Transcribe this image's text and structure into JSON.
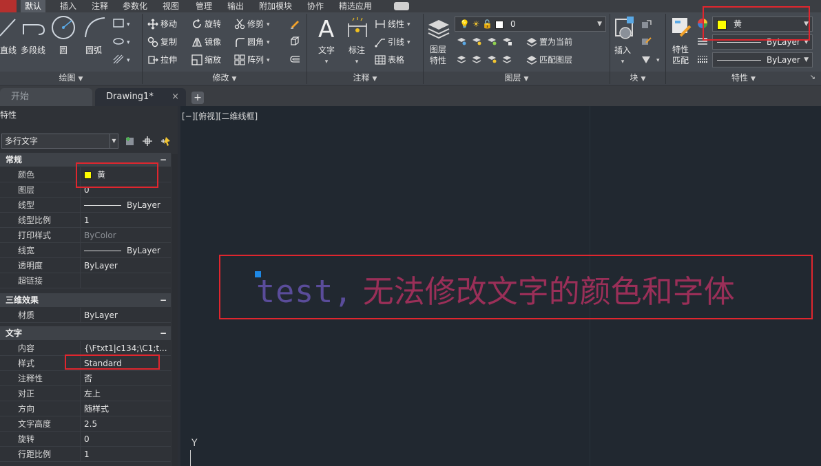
{
  "menu": {
    "tabs": [
      "默认",
      "插入",
      "注释",
      "参数化",
      "视图",
      "管理",
      "输出",
      "附加模块",
      "协作",
      "精选应用"
    ]
  },
  "ribbon": {
    "draw": {
      "title": "绘图",
      "line": "直线",
      "polyline": "多段线",
      "circle": "圆",
      "arc": "圆弧"
    },
    "modify": {
      "title": "修改",
      "move": "移动",
      "rotate": "旋转",
      "trim": "修剪",
      "copy": "复制",
      "mirror": "镜像",
      "fillet": "圆角",
      "stretch": "拉伸",
      "scale": "缩放",
      "array": "阵列"
    },
    "annotation": {
      "title": "注释",
      "text": "文字",
      "dimension": "标注",
      "linear": "线性",
      "leader": "引线",
      "table": "表格"
    },
    "layers": {
      "title": "图层",
      "layer_properties_line1": "图层",
      "layer_properties_line2": "特性",
      "layer_value": "0",
      "set_current": "置为当前",
      "match_layer": "匹配图层"
    },
    "block": {
      "title": "块",
      "insert": "插入"
    },
    "properties": {
      "title": "特性",
      "match_line1": "特性",
      "match_line2": "匹配",
      "color_value": "黄",
      "color_hex": "#ffff00",
      "linetype_value": "ByLayer",
      "lineweight_value": "ByLayer"
    }
  },
  "file_tabs": {
    "start": "开始",
    "drawing": "Drawing1*",
    "close": "×",
    "add": "+"
  },
  "properties_palette": {
    "title": "特性",
    "object_type": "多行文字",
    "sections": {
      "general": "常规",
      "three_d": "三维效果",
      "text": "文字",
      "collapse": "−"
    },
    "general": {
      "color_label": "颜色",
      "color_value": "黄",
      "layer_label": "图层",
      "layer_value": "0",
      "linetype_label": "线型",
      "linetype_value": "ByLayer",
      "ltscale_label": "线型比例",
      "ltscale_value": "1",
      "plotstyle_label": "打印样式",
      "plotstyle_value": "ByColor",
      "lineweight_label": "线宽",
      "lineweight_value": "ByLayer",
      "transparency_label": "透明度",
      "transparency_value": "ByLayer",
      "hyperlink_label": "超链接",
      "hyperlink_value": ""
    },
    "three_d": {
      "material_label": "材质",
      "material_value": "ByLayer"
    },
    "text": {
      "contents_label": "内容",
      "contents_value": "{\\Ftxt1|c134;\\C1;t...",
      "style_label": "样式",
      "style_value": "Standard",
      "annotative_label": "注释性",
      "annotative_value": "否",
      "justify_label": "对正",
      "justify_value": "左上",
      "direction_label": "方向",
      "direction_value": "随样式",
      "height_label": "文字高度",
      "height_value": "2.5",
      "rotation_label": "旋转",
      "rotation_value": "0",
      "linespacing_label": "行距比例",
      "linespacing_value": "1"
    }
  },
  "viewport": {
    "label": "[−][俯视][二维线框]",
    "mtext_latin": "test,",
    "mtext_cjk": " 无法修改文字的颜色和字体",
    "ucs_y": "Y"
  }
}
